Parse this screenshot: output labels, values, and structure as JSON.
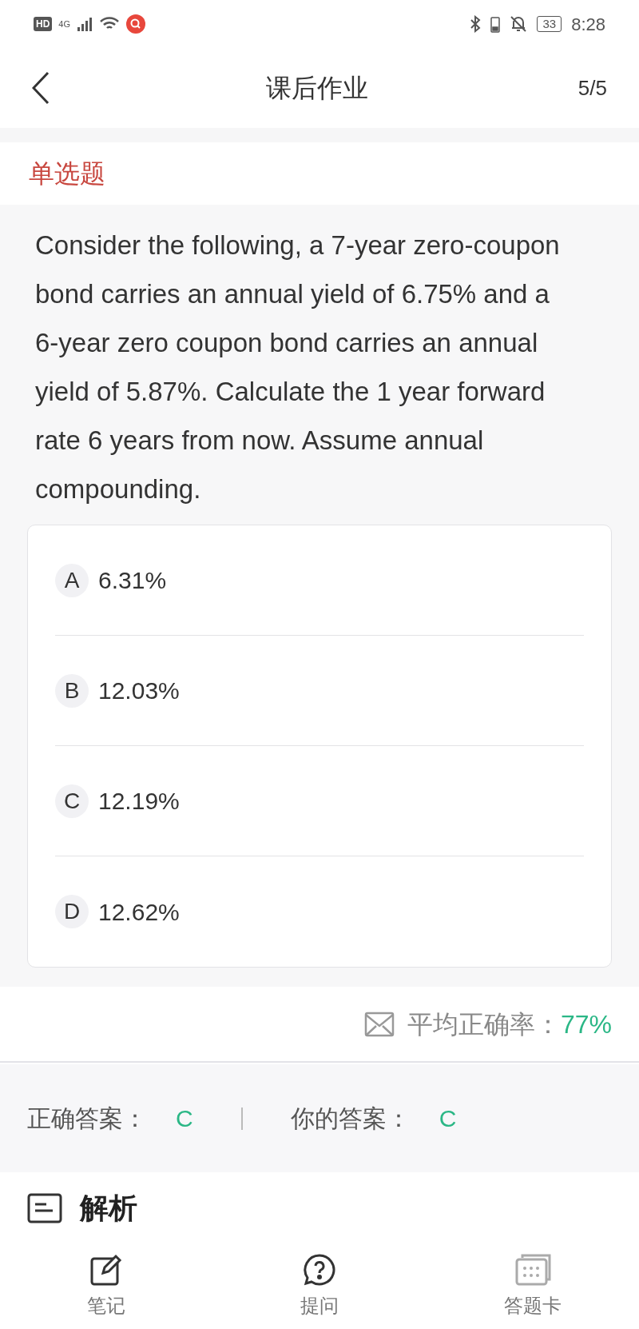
{
  "status_bar": {
    "network_badge": "HD",
    "network_type": "4G",
    "battery": "33",
    "time": "8:28"
  },
  "header": {
    "title": "课后作业",
    "progress": "5/5"
  },
  "question_type": "单选题",
  "question": "Consider the following, a 7-year zero-coupon bond carries an annual yield of 6.75% and a 6-year zero coupon bond carries an annual yield of 5.87%. Calculate the 1 year forward rate 6 years from now. Assume annual compounding.",
  "options": [
    {
      "letter": "A",
      "text": "6.31%"
    },
    {
      "letter": "B",
      "text": "12.03%"
    },
    {
      "letter": "C",
      "text": "12.19%"
    },
    {
      "letter": "D",
      "text": "12.62%"
    }
  ],
  "average": {
    "label": "平均正确率：",
    "value": "77%"
  },
  "answers": {
    "correct_label": "正确答案：",
    "correct": "C",
    "yours_label": "你的答案：",
    "yours": "C"
  },
  "analysis": {
    "title": "解析"
  },
  "bottom_nav": [
    {
      "kind": "note",
      "label": "笔记"
    },
    {
      "kind": "ask",
      "label": "提问"
    },
    {
      "kind": "card",
      "label": "答题卡"
    }
  ]
}
